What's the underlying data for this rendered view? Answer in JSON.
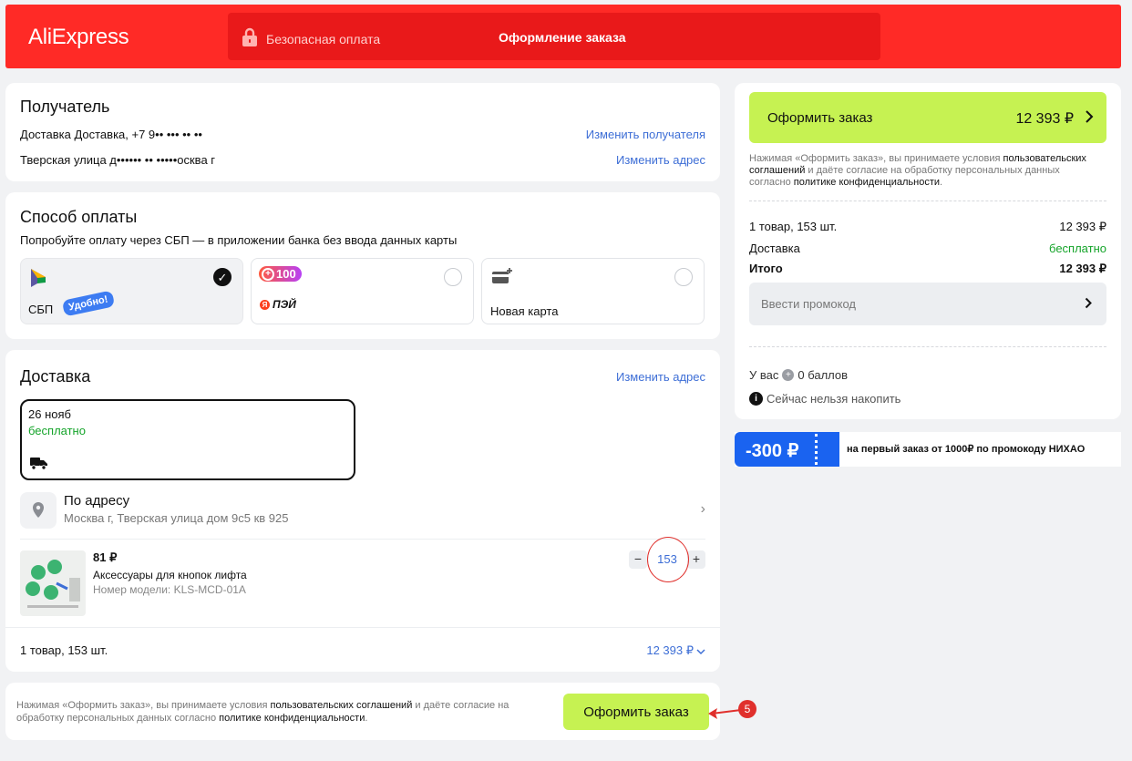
{
  "header": {
    "logo": "AliExpress",
    "secure_label": "Безопасная оплата",
    "title": "Оформление заказа",
    "bg_color": "#ff2a26"
  },
  "recipient": {
    "heading": "Получатель",
    "line1": "Доставка Доставка, +7 9•• ••• •• ••",
    "line2": "Тверская улица д•••••• •• •••••осква г",
    "change_recipient": "Изменить получателя",
    "change_address": "Изменить адрес"
  },
  "payment": {
    "heading": "Способ оплаты",
    "subtitle": "Попробуйте оплату через СБП — в приложении банка без ввода данных карты",
    "options": [
      {
        "label": "СБП",
        "badge": "Удобно!",
        "icon": "sbp-icon",
        "selected": true
      },
      {
        "label": "ПЭЙ",
        "badge": "100",
        "icon": "yandex-pay-icon",
        "selected": false
      },
      {
        "label": "Новая карта",
        "icon": "card-add-icon",
        "selected": false
      }
    ]
  },
  "delivery": {
    "heading": "Доставка",
    "change_address": "Изменить адрес",
    "date": "26 нояб",
    "price": "бесплатно",
    "address_title": "По адресу",
    "address_line": "Москва г, Тверская улица дом 9с5 кв 925",
    "item": {
      "price": "81 ₽",
      "name": "Аксессуары для кнопок лифта",
      "model": "Номер модели: KLS-MCD-01A",
      "quantity": "153",
      "minus": "−",
      "plus": "+"
    },
    "summary_left": "1 товар, 153 шт.",
    "summary_right": "12 393 ₽"
  },
  "bottom": {
    "terms_prefix": "Нажимая «Оформить заказ», вы принимаете условия ",
    "terms_link1": "пользовательских соглашений",
    "terms_mid": " и даёте согласие на обработку персональных данных согласно ",
    "terms_link2": "политике конфиденциальности",
    "terms_suffix": ".",
    "button": "Оформить заказ",
    "step_badge": "5"
  },
  "sidebar": {
    "button_label": "Оформить заказ",
    "button_price": "12 393 ₽",
    "terms_prefix": "Нажимая «Оформить заказ», вы принимаете условия ",
    "terms_link1": "пользовательских соглашений",
    "terms_mid": " и даёте согласие на обработку персональных данных согласно ",
    "terms_link2": "политике конфиденциальности",
    "terms_suffix": ".",
    "items_label": "1 товар, 153 шт.",
    "items_value": "12 393 ₽",
    "delivery_label": "Доставка",
    "delivery_value": "бесплатно",
    "total_label": "Итого",
    "total_value": "12 393 ₽",
    "promo_placeholder": "Ввести промокод",
    "points_prefix": "У вас",
    "points_value": "0 баллов",
    "points_note": "Сейчас нельзя накопить"
  },
  "promo_banner": {
    "amount": "-300 ₽",
    "text": "на первый заказ от 1000₽ по промокоду НИХАО"
  }
}
